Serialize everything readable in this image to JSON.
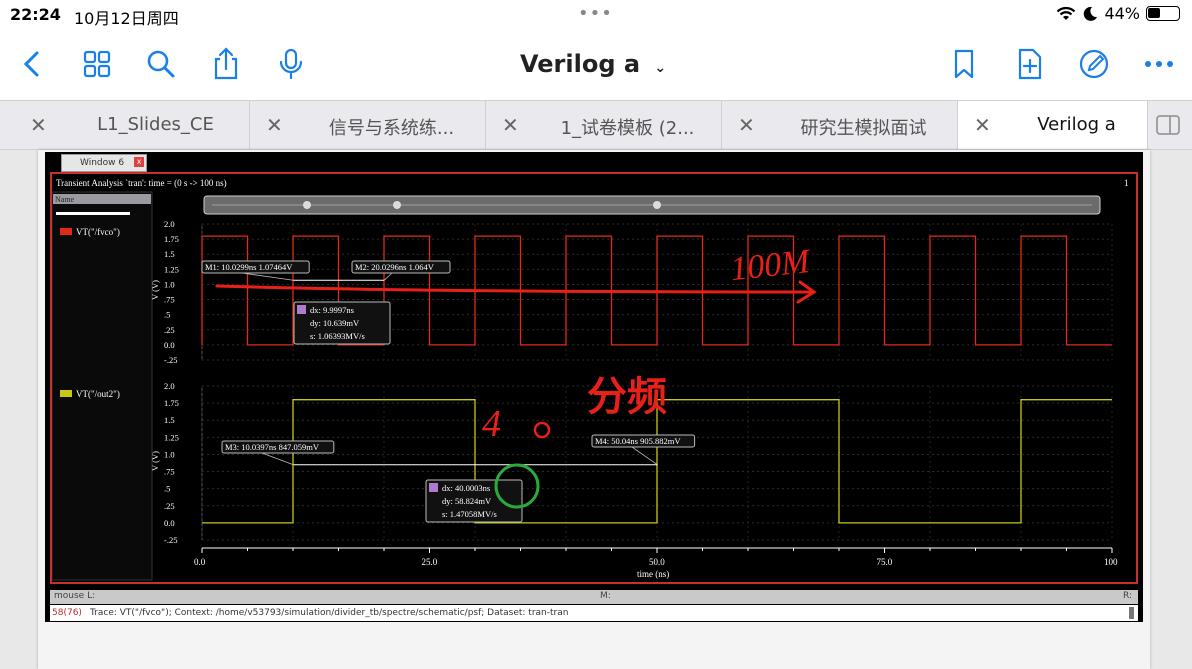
{
  "status_bar": {
    "time": "22:24",
    "date": "10月12日周四",
    "battery": "44%",
    "battery_level": 0.44
  },
  "toolbar": {
    "doc_title": "Verilog a"
  },
  "tabs": [
    {
      "label": "L1_Slides_CE",
      "active": false
    },
    {
      "label": "信号与系统练...",
      "active": false
    },
    {
      "label": "1_试卷模板 (2...",
      "active": false
    },
    {
      "label": "研究生模拟面试",
      "active": false
    },
    {
      "label": "Verilog a",
      "active": true
    }
  ],
  "screenshot": {
    "window_tab": "Window 6",
    "analysis_title": "Transient Analysis `tran': time = (0 s -> 100 ns)",
    "top_right_index": "1",
    "legend_header": "Name",
    "trace1_name": "VT(\"/fvco\")",
    "trace2_name": "VT(\"/out2\")",
    "trace1_color": "#e02a1a",
    "trace2_color": "#c8c814",
    "y_axis_label": "V (V)",
    "y_ticks": [
      "2.0",
      "1.75",
      "1.5",
      "1.25",
      "1.0",
      ".75",
      ".5",
      ".25",
      "0.0",
      "-.25"
    ],
    "x_axis_label": "time (ns)",
    "x_ticks": [
      "0.0",
      "25.0",
      "50.0",
      "75.0",
      "100"
    ],
    "markers": {
      "m1": "M1: 10.0299ns 1.07464V",
      "m2": "M2: 20.0296ns 1.064V",
      "m3": "M3: 10.0397ns 847.059mV",
      "m4": "M4: 50.04ns 905.882mV"
    },
    "delta1": {
      "dx": "dx: 9.9997ns",
      "dy": "dy: 10.639mV",
      "s": "s: 1.06393MV/s"
    },
    "delta2": {
      "dx": "dx: 40.0003ns",
      "dy": "dy: 58.824mV",
      "s": "s: 1.47058MV/s"
    },
    "annotations": {
      "freq": "100M",
      "div": "4",
      "fenpin": "分频"
    },
    "mouse_bar": {
      "left": "mouse L:",
      "mid": "M:",
      "right": "R:"
    },
    "trace_info": "Trace: VT(\"/fvco\"); Context: /home/v53793/simulation/divider_tb/spectre/schematic/psf; Dataset: tran-tran",
    "trace_number": "58(76)",
    "fvco_period_ns": 10,
    "out2_period_ns": 40
  }
}
